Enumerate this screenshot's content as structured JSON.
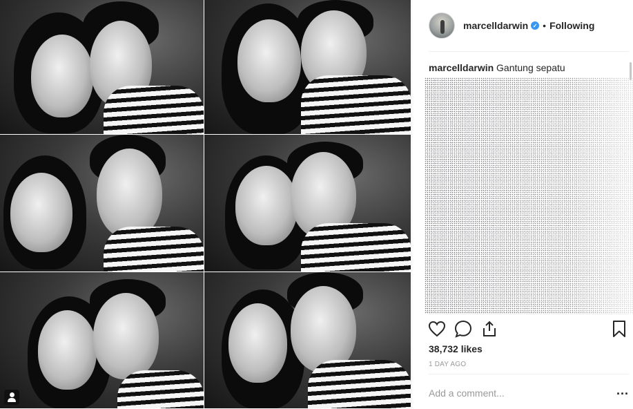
{
  "post": {
    "username": "marcelldarwin",
    "verified_icon": "verified-badge-icon",
    "separator": "•",
    "follow_status": "Following",
    "caption_user": "marcelldarwin",
    "caption_text": "Gantung sepatu",
    "likes": "38,732 likes",
    "time_ago": "1 DAY AGO",
    "comment_placeholder": "Add a comment...",
    "more_label": "..."
  },
  "icons": {
    "like": "heart-icon",
    "comment": "comment-icon",
    "share": "share-icon",
    "save": "bookmark-icon",
    "tagged": "user-tag-icon"
  },
  "colors": {
    "verified": "#3897f0",
    "text": "#262626",
    "muted": "#999999"
  }
}
